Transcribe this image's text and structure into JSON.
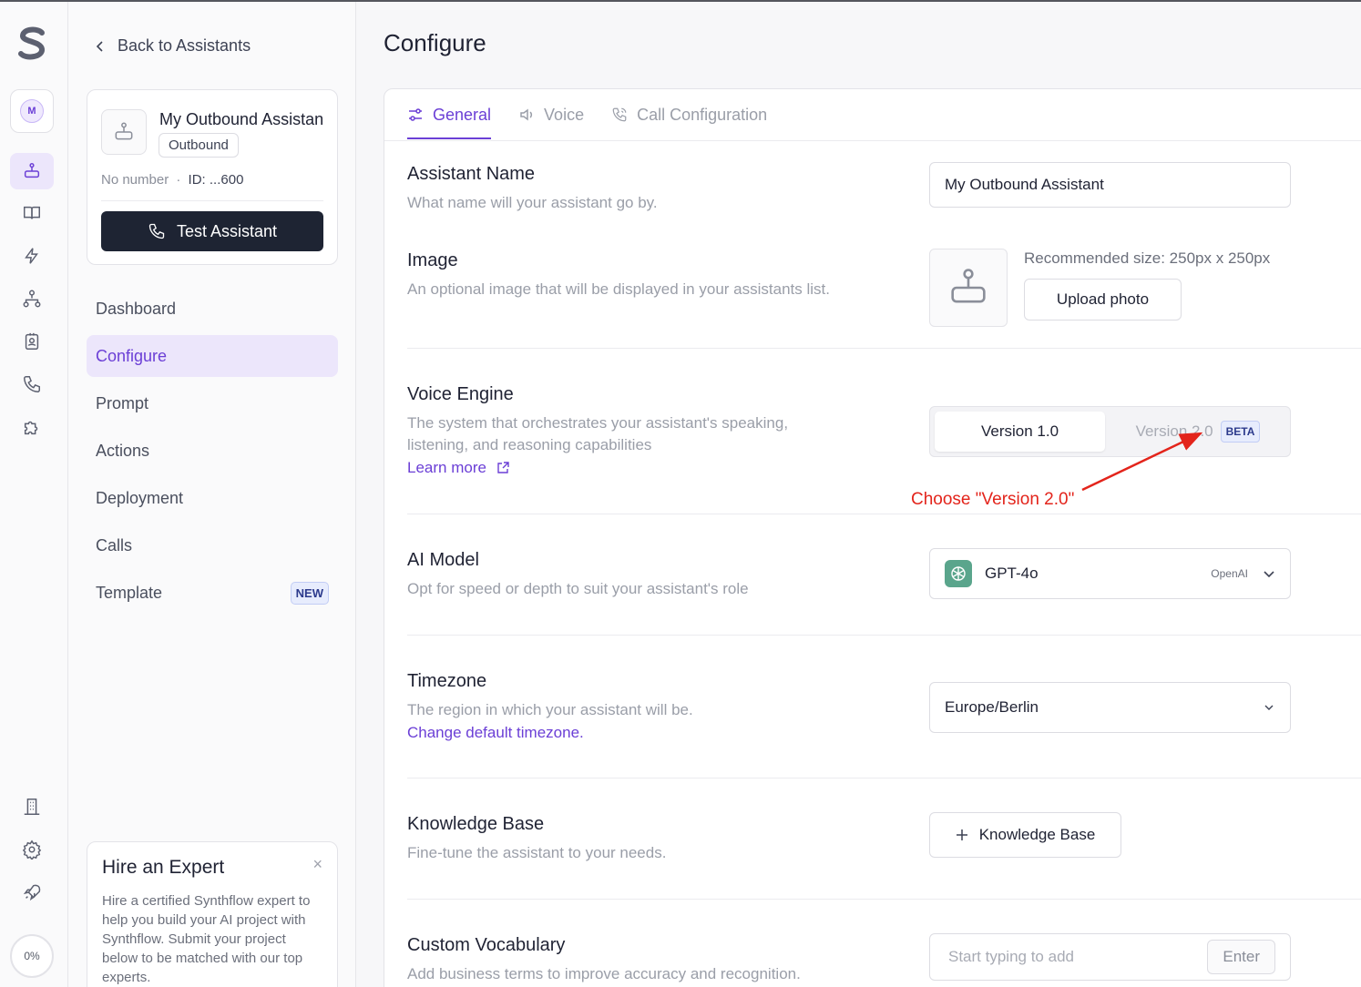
{
  "rail": {
    "avatar_initial": "M",
    "icons": [
      "assistant-icon",
      "book-icon",
      "bolt-icon",
      "hierarchy-icon",
      "contact-icon",
      "phone-icon",
      "puzzle-icon",
      "building-icon",
      "gear-icon",
      "rocket-icon"
    ],
    "progress": "0%"
  },
  "sidebar": {
    "back_label": "Back to Assistants",
    "assistant": {
      "name": "My Outbound Assistant",
      "type": "Outbound",
      "number": "No number",
      "separator": "·",
      "id": "ID: ...600",
      "test_label": "Test Assistant"
    },
    "nav": [
      {
        "label": "Dashboard"
      },
      {
        "label": "Configure",
        "active": true
      },
      {
        "label": "Prompt"
      },
      {
        "label": "Actions"
      },
      {
        "label": "Deployment"
      },
      {
        "label": "Calls"
      },
      {
        "label": "Template",
        "badge": "NEW"
      }
    ],
    "expert": {
      "title": "Hire an Expert",
      "body": "Hire a certified Synthflow expert to help you build your AI project with Synthflow. Submit your project below to be matched with our top experts.",
      "close": "×"
    }
  },
  "main": {
    "title": "Configure",
    "tabs": [
      {
        "label": "General",
        "active": true
      },
      {
        "label": "Voice"
      },
      {
        "label": "Call Configuration"
      }
    ],
    "assistant_name": {
      "label": "Assistant Name",
      "desc": "What name will your assistant go by.",
      "value": "My Outbound Assistant"
    },
    "image": {
      "label": "Image",
      "desc": "An optional image that will be displayed in your assistants list.",
      "recommended": "Recommended size: 250px x 250px",
      "upload_label": "Upload photo"
    },
    "voice_engine": {
      "label": "Voice Engine",
      "desc": "The system that orchestrates your assistant's speaking, listening, and reasoning capabilities",
      "learn_more": "Learn more",
      "options": [
        "Version 1.0",
        "Version 2.0"
      ],
      "selected": "Version 1.0",
      "beta": "BETA",
      "annotation": "Choose \"Version 2.0\""
    },
    "ai_model": {
      "label": "AI Model",
      "desc": "Opt for speed or depth to suit your assistant's role",
      "value": "GPT-4o",
      "provider": "OpenAI"
    },
    "timezone": {
      "label": "Timezone",
      "desc": "The region in which your assistant will be.",
      "link": "Change default timezone.",
      "value": "Europe/Berlin"
    },
    "knowledge_base": {
      "label": "Knowledge Base",
      "desc": "Fine-tune the assistant to your needs.",
      "button": "Knowledge Base"
    },
    "vocabulary": {
      "label": "Custom Vocabulary",
      "desc": "Add business terms to improve accuracy and recognition.",
      "placeholder": "Start typing to add",
      "enter": "Enter"
    }
  },
  "colors": {
    "accent": "#6b3fd6",
    "annotation": "#e3241b",
    "primary_button": "#1e2433"
  }
}
